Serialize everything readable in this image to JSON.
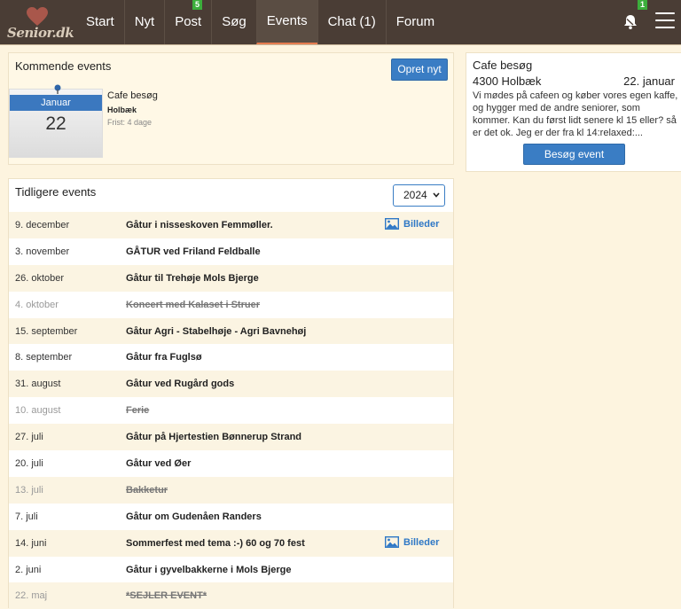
{
  "header": {
    "logo_text": "Senior.dk",
    "nav": [
      {
        "label": "Start"
      },
      {
        "label": "Nyt"
      },
      {
        "label": "Post",
        "badge": "5"
      },
      {
        "label": "Søg"
      },
      {
        "label": "Events",
        "active": true
      },
      {
        "label": "Chat (1)"
      },
      {
        "label": "Forum"
      }
    ],
    "notification_badge": "1"
  },
  "upcoming": {
    "title": "Kommende events",
    "create_button": "Opret nyt",
    "event": {
      "month": "Januar",
      "day": "22",
      "title": "Cafe besøg",
      "place": "Holbæk",
      "deadline": "Frist: 4 dage"
    }
  },
  "detail": {
    "title": "Cafe besøg",
    "location": "4300 Holbæk",
    "date": "22. januar",
    "description": "Vi mødes på cafeen og køber vores egen kaffe, og hygger med de andre seniorer, som kommer. Kan du først lidt senere kl 15 eller? så er det ok. Jeg er der fra kl 14:relaxed:...",
    "visit_button": "Besøg event"
  },
  "previous": {
    "title": "Tidligere events",
    "year": "2024",
    "images_label": "Billeder",
    "rows": [
      {
        "date": "9. december",
        "name": "Gåtur i nisseskoven Femmøller.",
        "cancelled": false,
        "images": true
      },
      {
        "date": "3. november",
        "name": "GÅTUR ved Friland Feldballe",
        "cancelled": false,
        "images": false
      },
      {
        "date": "26. oktober",
        "name": "Gåtur til Trehøje Mols Bjerge",
        "cancelled": false,
        "images": false
      },
      {
        "date": "4. oktober",
        "name": "Koncert med Kalaset i Struer",
        "cancelled": true,
        "images": false
      },
      {
        "date": "15. september",
        "name": "Gåtur Agri - Stabelhøje - Agri Bavnehøj",
        "cancelled": false,
        "images": false
      },
      {
        "date": "8. september",
        "name": "Gåtur fra Fuglsø",
        "cancelled": false,
        "images": false
      },
      {
        "date": "31. august",
        "name": "Gåtur ved Rugård gods",
        "cancelled": false,
        "images": false
      },
      {
        "date": "10. august",
        "name": "Ferie",
        "cancelled": true,
        "images": false
      },
      {
        "date": "27. juli",
        "name": "Gåtur på Hjertestien Bønnerup Strand",
        "cancelled": false,
        "images": false
      },
      {
        "date": "20. juli",
        "name": "Gåtur ved Øer",
        "cancelled": false,
        "images": false
      },
      {
        "date": "13. juli",
        "name": "Bakketur",
        "cancelled": true,
        "images": false
      },
      {
        "date": "7. juli",
        "name": "Gåtur om Gudenåen Randers",
        "cancelled": false,
        "images": false
      },
      {
        "date": "14. juni",
        "name": "Sommerfest med tema :-) 60 og 70 fest",
        "cancelled": false,
        "images": true
      },
      {
        "date": "2. juni",
        "name": "Gåtur i gyvelbakkerne i Mols Bjerge",
        "cancelled": false,
        "images": false
      },
      {
        "date": "22. maj",
        "name": "*SEJLER EVENT*",
        "cancelled": true,
        "images": false
      }
    ]
  },
  "colors": {
    "nav_bg": "#4a3d35",
    "accent_blue": "#3a7dc4",
    "page_bg": "#fdf4df",
    "badge_green": "#3cae3c",
    "active_underline": "#e57c50"
  }
}
